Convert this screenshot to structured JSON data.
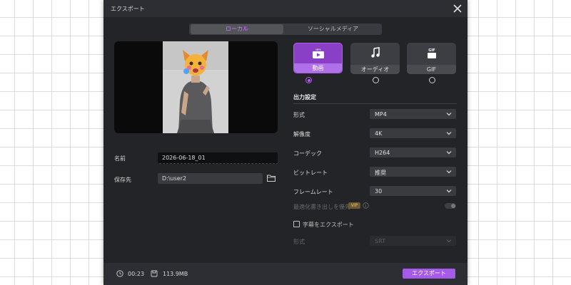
{
  "dialog": {
    "title": "エクスポート"
  },
  "tabs": {
    "local": "ローカル",
    "social": "ソーシャルメディア"
  },
  "file": {
    "name_label": "名前",
    "name_value": "2026-06-18_01",
    "path_label": "保存先",
    "path_value": "D:\\user2"
  },
  "formats": [
    {
      "label": "動画",
      "badge": "MP4",
      "selected": true
    },
    {
      "label": "オーディオ",
      "selected": false
    },
    {
      "label": "GIF",
      "badge": "GIF",
      "selected": false
    }
  ],
  "output": {
    "section_title": "出力設定",
    "format_label": "形式",
    "format_value": "MP4",
    "resolution_label": "解像度",
    "resolution_value": "4K",
    "codec_label": "コーデック",
    "codec_value": "H264",
    "bitrate_label": "ビットレート",
    "bitrate_value": "推奨",
    "framerate_label": "フレームレート",
    "framerate_value": "30",
    "optimize_label": "最適化書き出しを優先",
    "vip_badge": "VIP",
    "subtitle_label": "字幕をエクスポート",
    "subtitle_format_label": "形式",
    "subtitle_format_value": "SRT"
  },
  "footer": {
    "duration": "00:23",
    "size": "113.9MB",
    "export_button": "エクスポート"
  },
  "colors": {
    "accent": "#a55ae8",
    "dialog_bg": "#232428",
    "field_bg": "#3a3b40"
  }
}
